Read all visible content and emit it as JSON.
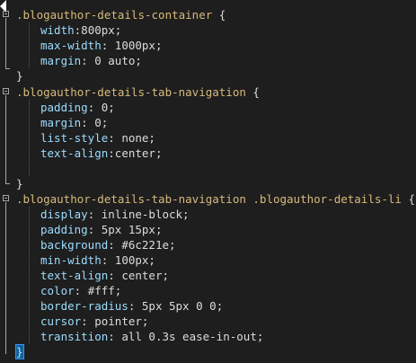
{
  "code": {
    "block1": {
      "selector": ".blogauthor-details-container",
      "open": "{",
      "lines": [
        {
          "prop": "width",
          "sep": ":",
          "value": "800px;"
        },
        {
          "prop": "max-width",
          "sep": ": ",
          "value": "1000px;"
        },
        {
          "prop": "margin",
          "sep": ": ",
          "value": "0 auto;"
        }
      ],
      "close": "}"
    },
    "block2": {
      "selector": ".blogauthor-details-tab-navigation",
      "open": "{",
      "lines": [
        {
          "prop": "padding",
          "sep": ": ",
          "value": "0;"
        },
        {
          "prop": "margin",
          "sep": ": ",
          "value": "0;"
        },
        {
          "prop": "list-style",
          "sep": ": ",
          "value": "none;"
        },
        {
          "prop": "text-align",
          "sep": ":",
          "value": "center;"
        }
      ],
      "close": "}"
    },
    "block3": {
      "selector": ".blogauthor-details-tab-navigation .blogauthor-details-li",
      "open": "{",
      "lines": [
        {
          "prop": "display",
          "sep": ": ",
          "value": "inline-block;"
        },
        {
          "prop": "padding",
          "sep": ": ",
          "value": "5px 15px;"
        },
        {
          "prop": "background",
          "sep": ": ",
          "value": "#6c221e;"
        },
        {
          "prop": "min-width",
          "sep": ": ",
          "value": "100px;"
        },
        {
          "prop": "text-align",
          "sep": ": ",
          "value": "center;"
        },
        {
          "prop": "color",
          "sep": ": ",
          "value": "#fff;"
        },
        {
          "prop": "border-radius",
          "sep": ": ",
          "value": "5px 5px 0 0;"
        },
        {
          "prop": "cursor",
          "sep": ": ",
          "value": "pointer;"
        },
        {
          "prop": "transition",
          "sep": ": ",
          "value": "all 0.3s ease-in-out;"
        }
      ],
      "close": "}"
    }
  },
  "colors": {
    "background": "#1e1e1e",
    "selector": "#d7ba7d",
    "property": "#9cdcfe",
    "value": "#dcdcdc"
  },
  "icons": {
    "fold": "fold-collapse-icon",
    "marker": "breakpoint-arrow-icon"
  }
}
